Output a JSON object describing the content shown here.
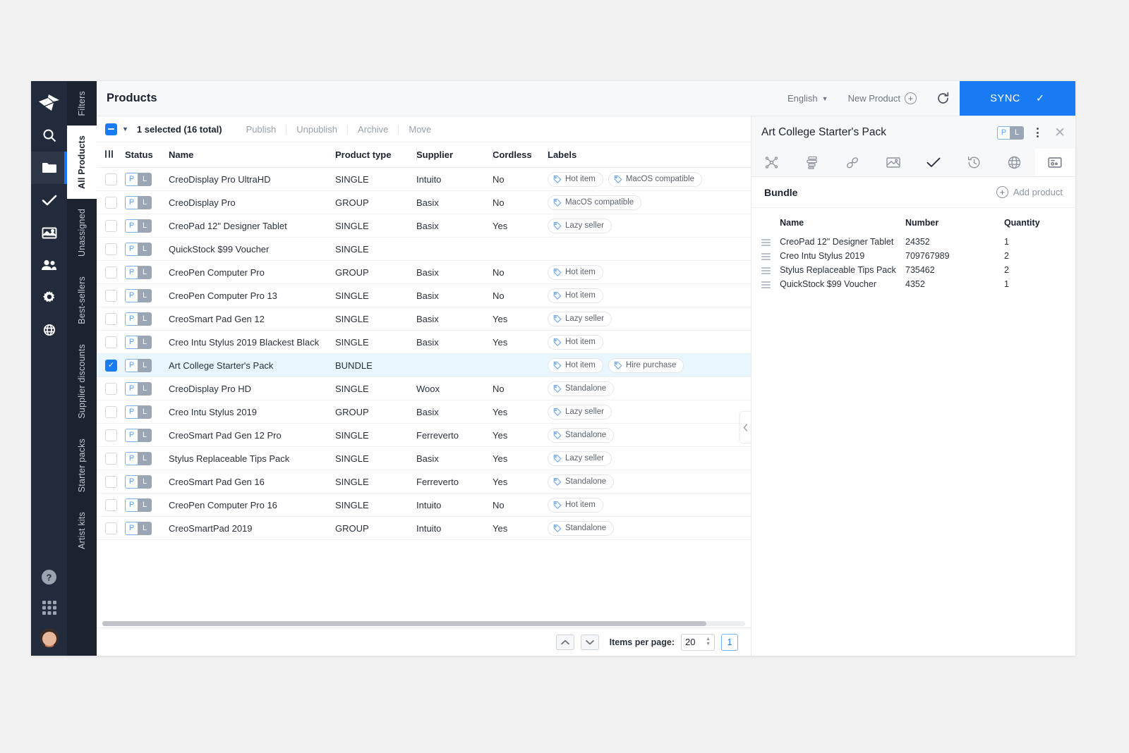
{
  "rail": {
    "logo_icon": "origami-logo-icon",
    "items": [
      {
        "name": "search-icon",
        "active": false
      },
      {
        "name": "folder-icon",
        "active": true
      },
      {
        "name": "check-icon",
        "active": false
      },
      {
        "name": "image-icon",
        "active": false
      },
      {
        "name": "users-icon",
        "active": false
      },
      {
        "name": "gear-icon",
        "active": false
      },
      {
        "name": "globe-icon",
        "active": false
      }
    ],
    "bottom": [
      {
        "name": "help-icon"
      },
      {
        "name": "apps-grid-icon"
      }
    ],
    "avatar_name": "user-avatar"
  },
  "vtabs": [
    {
      "label": "Filters",
      "active": false
    },
    {
      "label": "All Products",
      "active": true
    },
    {
      "label": "Unassigned",
      "active": false
    },
    {
      "label": "Best-sellers",
      "active": false
    },
    {
      "label": "Supplier discounts",
      "active": false
    },
    {
      "label": "Starter packs",
      "active": false
    },
    {
      "label": "Artist kits",
      "active": false
    }
  ],
  "topbar": {
    "title": "Products",
    "language": "English",
    "language_caret": "▼",
    "new_product": "New Product",
    "refresh_icon": "refresh-icon",
    "sync_label": "SYNC",
    "sync_check": "✓",
    "sync_color": "#1a7cf5"
  },
  "actionbar": {
    "selection_state": "indeterminate",
    "dropdown_caret": "▼",
    "selected_text": "1 selected (16 total)",
    "actions": [
      "Publish",
      "Unpublish",
      "Archive",
      "Move"
    ]
  },
  "table": {
    "columns": [
      "Status",
      "Name",
      "Product type",
      "Supplier",
      "Cordless",
      "Labels"
    ],
    "grip_icon": "column-grip-icon",
    "rows": [
      {
        "status": [
          "P",
          "L"
        ],
        "name": "CreoDisplay Pro UltraHD",
        "type": "SINGLE",
        "supplier": "Intuito",
        "cordless": "No",
        "labels": [
          "Hot item",
          "MacOS compatible"
        ],
        "selected": false
      },
      {
        "status": [
          "P",
          "L"
        ],
        "name": "CreoDisplay Pro",
        "type": "GROUP",
        "supplier": "Basix",
        "cordless": "No",
        "labels": [
          "MacOS compatible"
        ],
        "selected": false
      },
      {
        "status": [
          "P",
          "L"
        ],
        "name": "CreoPad 12\" Designer Tablet",
        "type": "SINGLE",
        "supplier": "Basix",
        "cordless": "Yes",
        "labels": [
          "Lazy seller"
        ],
        "selected": false
      },
      {
        "status": [
          "P",
          "L"
        ],
        "name": "QuickStock $99 Voucher",
        "type": "SINGLE",
        "supplier": "",
        "cordless": "",
        "labels": [],
        "selected": false
      },
      {
        "status": [
          "P",
          "L"
        ],
        "name": "CreoPen Computer Pro",
        "type": "GROUP",
        "supplier": "Basix",
        "cordless": "No",
        "labels": [
          "Hot item"
        ],
        "selected": false
      },
      {
        "status": [
          "P",
          "L"
        ],
        "name": "CreoPen Computer Pro 13",
        "type": "SINGLE",
        "supplier": "Basix",
        "cordless": "No",
        "labels": [
          "Hot item"
        ],
        "selected": false
      },
      {
        "status": [
          "P",
          "L"
        ],
        "name": "CreoSmart Pad Gen 12",
        "type": "SINGLE",
        "supplier": "Basix",
        "cordless": "Yes",
        "labels": [
          "Lazy seller"
        ],
        "selected": false
      },
      {
        "status": [
          "P",
          "L"
        ],
        "name": "Creo Intu Stylus 2019 Blackest Black",
        "type": "SINGLE",
        "supplier": "Basix",
        "cordless": "Yes",
        "labels": [
          "Hot item"
        ],
        "selected": false
      },
      {
        "status": [
          "P",
          "L"
        ],
        "name": "Art College Starter's Pack",
        "type": "BUNDLE",
        "supplier": "",
        "cordless": "",
        "labels": [
          "Hot item",
          "Hire purchase"
        ],
        "selected": true
      },
      {
        "status": [
          "P",
          "L"
        ],
        "name": "CreoDisplay Pro HD",
        "type": "SINGLE",
        "supplier": "Woox",
        "cordless": "No",
        "labels": [
          "Standalone"
        ],
        "selected": false
      },
      {
        "status": [
          "P",
          "L"
        ],
        "name": "Creo Intu Stylus 2019",
        "type": "GROUP",
        "supplier": "Basix",
        "cordless": "Yes",
        "labels": [
          "Lazy seller"
        ],
        "selected": false
      },
      {
        "status": [
          "P",
          "L"
        ],
        "name": "CreoSmart Pad Gen 12 Pro",
        "type": "SINGLE",
        "supplier": "Ferreverto",
        "cordless": "Yes",
        "labels": [
          "Standalone"
        ],
        "selected": false
      },
      {
        "status": [
          "P",
          "L"
        ],
        "name": "Stylus Replaceable Tips Pack",
        "type": "SINGLE",
        "supplier": "Basix",
        "cordless": "Yes",
        "labels": [
          "Lazy seller"
        ],
        "selected": false
      },
      {
        "status": [
          "P",
          "L"
        ],
        "name": "CreoSmart Pad Gen 16",
        "type": "SINGLE",
        "supplier": "Ferreverto",
        "cordless": "Yes",
        "labels": [
          "Standalone"
        ],
        "selected": false
      },
      {
        "status": [
          "P",
          "L"
        ],
        "name": "CreoPen Computer Pro 16",
        "type": "SINGLE",
        "supplier": "Intuito",
        "cordless": "No",
        "labels": [
          "Hot item"
        ],
        "selected": false
      },
      {
        "status": [
          "P",
          "L"
        ],
        "name": "CreoSmartPad 2019",
        "type": "GROUP",
        "supplier": "Intuito",
        "cordless": "Yes",
        "labels": [
          "Standalone"
        ],
        "selected": false
      }
    ]
  },
  "collapse_handle_icon": "chevron-left-icon",
  "pagination": {
    "up_icon": "chevron-up-icon",
    "down_icon": "chevron-down-icon",
    "items_per_page_label": "Items per page:",
    "items_per_page_value": "20",
    "current_page": "1"
  },
  "panel": {
    "title": "Art College Starter's Pack",
    "status": [
      "P",
      "L"
    ],
    "kebab_icon": "kebab-menu-icon",
    "close_icon": "close-icon",
    "tabs": [
      {
        "name": "relations-icon",
        "active": false
      },
      {
        "name": "attributes-icon",
        "active": false
      },
      {
        "name": "links-icon",
        "active": false
      },
      {
        "name": "media-icon",
        "active": false
      },
      {
        "name": "completeness-check-icon",
        "active": false
      },
      {
        "name": "history-icon",
        "active": false
      },
      {
        "name": "channels-globe-icon",
        "active": false
      },
      {
        "name": "bundle-icon",
        "active": true
      }
    ],
    "section_title": "Bundle",
    "add_product_label": "Add product",
    "add_product_icon": "plus-circle-icon",
    "bundle_columns": [
      "Name",
      "Number",
      "Quantity"
    ],
    "bundle_rows": [
      {
        "name": "CreoPad 12\" Designer Tablet",
        "number": "24352",
        "quantity": "1"
      },
      {
        "name": "Creo Intu Stylus 2019",
        "number": "709767989",
        "quantity": "2"
      },
      {
        "name": "Stylus Replaceable Tips Pack",
        "number": "735462",
        "quantity": "2"
      },
      {
        "name": "QuickStock $99 Voucher",
        "number": "4352",
        "quantity": "1"
      }
    ]
  }
}
